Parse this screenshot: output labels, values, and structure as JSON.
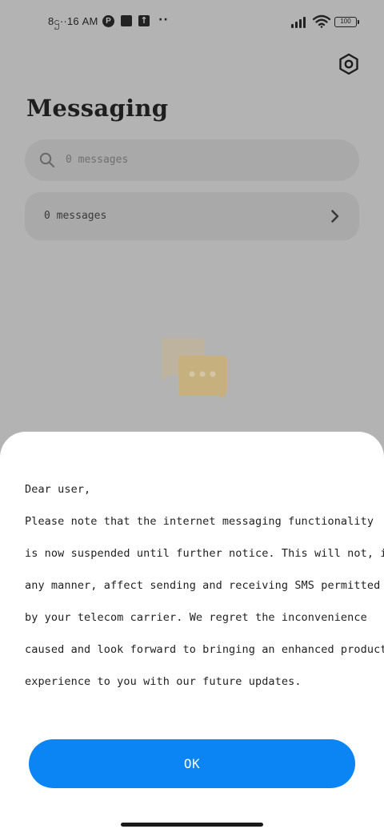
{
  "status_bar": {
    "time": "8ဌ··16 AM",
    "p_badge": "P",
    "upload_glyph": "↑",
    "dots": "··",
    "battery": "100",
    "icons": [
      "p-badge-icon",
      "square-notification-icon",
      "upload-icon",
      "more-dots-icon",
      "signal-icon",
      "wifi-icon",
      "battery-icon"
    ]
  },
  "header": {
    "title": "Messaging",
    "settings_icon": "settings-hexagon-icon"
  },
  "search": {
    "placeholder": "0 messages",
    "icon": "search-icon"
  },
  "list": {
    "row_label": "0 messages",
    "row_icon": "chevron-right-icon"
  },
  "empty_state": {
    "icon": "chat-bubbles-icon",
    "color": "#d9bf8a"
  },
  "dialog": {
    "lines": [
      "Dear user,",
      "Please note that the internet messaging functionality",
      "is now suspended until further notice. This will not, in",
      "any manner, affect sending and receiving SMS permitted",
      "by your telecom carrier. We regret the inconvenience",
      "caused and look forward to bringing an enhanced product",
      "experience to you with our future updates."
    ],
    "ok_label": "OK",
    "accent": "#0b84f4"
  }
}
